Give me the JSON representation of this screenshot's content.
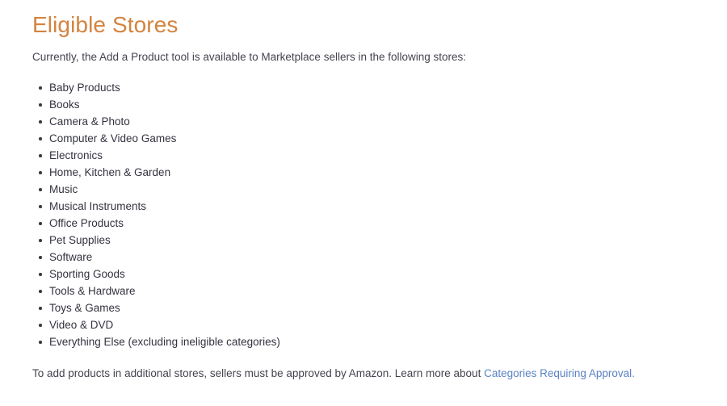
{
  "page": {
    "title": "Eligible Stores",
    "title_color": "#d4833f",
    "intro": "Currently, the Add a Product tool is available to Marketplace sellers in the following stores:",
    "stores": [
      "Baby Products",
      "Books",
      "Camera & Photo",
      "Computer & Video Games",
      "Electronics",
      "Home, Kitchen & Garden",
      "Music",
      "Musical Instruments",
      "Office Products",
      "Pet Supplies",
      "Software",
      "Sporting Goods",
      "Tools & Hardware",
      "Toys & Games",
      "Video & DVD",
      "Everything Else (excluding ineligible categories)"
    ],
    "footer": {
      "text_before_link": "To add products in additional stores, sellers must be approved by Amazon. Learn more about ",
      "link_label": "Categories Requiring Approval.",
      "link_color": "#5b82c4"
    },
    "bullet_icon": "bullet-disc-icon"
  }
}
